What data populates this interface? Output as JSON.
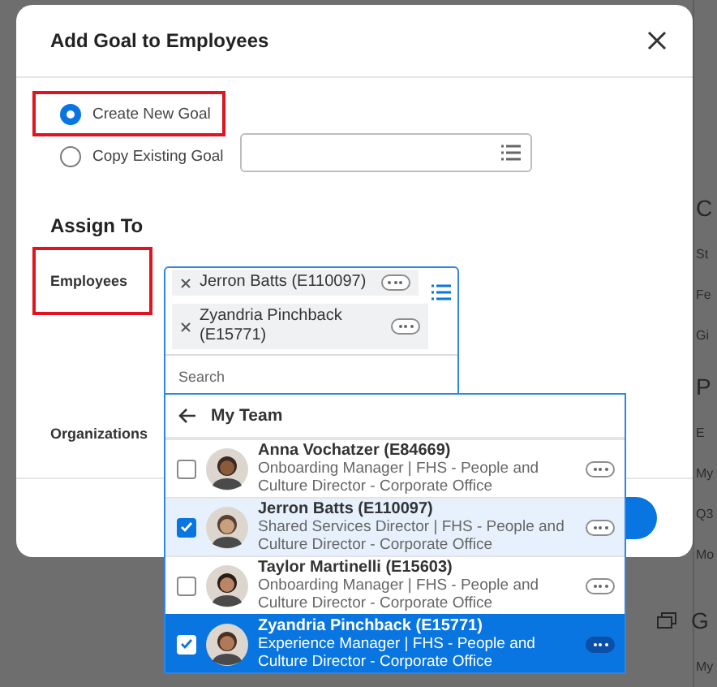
{
  "background_page": {
    "items": [
      {
        "text": "C",
        "kind": "heading"
      },
      {
        "text": "St",
        "kind": "text"
      },
      {
        "text": "Fe",
        "kind": "text"
      },
      {
        "text": "Gi",
        "kind": "text"
      },
      {
        "text": "P",
        "kind": "heading"
      },
      {
        "text": "E",
        "kind": "text"
      },
      {
        "text": "My",
        "kind": "text"
      },
      {
        "text": "Q3",
        "kind": "text"
      },
      {
        "text": "Mo",
        "kind": "text"
      },
      {
        "text": "G",
        "kind": "section"
      },
      {
        "text": "My",
        "kind": "text"
      }
    ]
  },
  "modal": {
    "title": "Add Goal to Employees",
    "goal_options": [
      {
        "label": "Create New Goal",
        "selected": true,
        "annotated": true
      },
      {
        "label": "Copy Existing Goal",
        "selected": false,
        "annotated": false
      }
    ],
    "assign_heading": "Assign To",
    "employees": {
      "label": "Employees",
      "annotated": true,
      "chips": [
        {
          "name": "Jerron Batts (E110097)"
        },
        {
          "name": "Zyandria Pinchback (E15771)"
        }
      ],
      "search_placeholder": "Search"
    },
    "organizations_label": "Organizations"
  },
  "picker": {
    "header": "My Team",
    "people": [
      {
        "name": "Anna Vochatzer (E84669)",
        "subtitle": "Onboarding Manager | FHS - People and Culture Director - Corporate Office",
        "checked": false,
        "selected": false
      },
      {
        "name": "Jerron Batts (E110097)",
        "subtitle": "Shared Services Director | FHS - People and Culture Director - Corporate Office",
        "checked": true,
        "selected": false
      },
      {
        "name": "Taylor Martinelli (E15603)",
        "subtitle": "Onboarding Manager | FHS - People and Culture Director - Corporate Office",
        "checked": false,
        "selected": false
      },
      {
        "name": "Zyandria Pinchback (E15771)",
        "subtitle": "Experience Manager | FHS - People and Culture Director - Corporate Office",
        "checked": true,
        "selected": true
      }
    ]
  }
}
